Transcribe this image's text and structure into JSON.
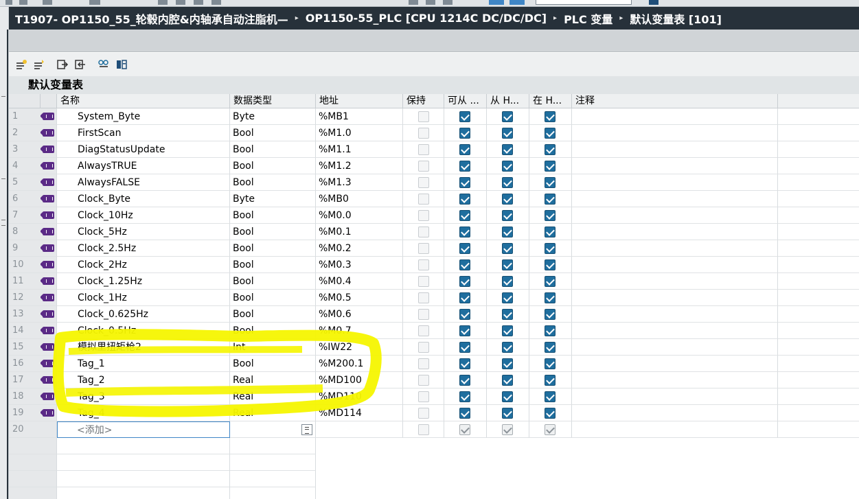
{
  "breadcrumb": [
    "T1907- OP1150_55_轮毂内腔&内轴承自动注脂机—",
    "OP1150-55_PLC [CPU 1214C DC/DC/DC]",
    "PLC 变量",
    "默认变量表 [101]"
  ],
  "breadcrumb_separator": "▸",
  "table_title": "默认变量表",
  "columns": {
    "name": "名称",
    "type": "数据类型",
    "address": "地址",
    "retain": "保持",
    "hmi_accessible": "可从 ...",
    "hmi_visible": "从 H...",
    "hmi_setpoint": "在 H...",
    "comment": "注释"
  },
  "rows": [
    {
      "num": "1",
      "name": "System_Byte",
      "type": "Byte",
      "address": "%MB1",
      "retain": false,
      "hmi1": true,
      "hmi2": true,
      "hmi3": true,
      "highlighted": false
    },
    {
      "num": "2",
      "name": "FirstScan",
      "type": "Bool",
      "address": "%M1.0",
      "retain": false,
      "hmi1": true,
      "hmi2": true,
      "hmi3": true,
      "highlighted": false
    },
    {
      "num": "3",
      "name": "DiagStatusUpdate",
      "type": "Bool",
      "address": "%M1.1",
      "retain": false,
      "hmi1": true,
      "hmi2": true,
      "hmi3": true,
      "highlighted": false
    },
    {
      "num": "4",
      "name": "AlwaysTRUE",
      "type": "Bool",
      "address": "%M1.2",
      "retain": false,
      "hmi1": true,
      "hmi2": true,
      "hmi3": true,
      "highlighted": false
    },
    {
      "num": "5",
      "name": "AlwaysFALSE",
      "type": "Bool",
      "address": "%M1.3",
      "retain": false,
      "hmi1": true,
      "hmi2": true,
      "hmi3": true,
      "highlighted": false
    },
    {
      "num": "6",
      "name": "Clock_Byte",
      "type": "Byte",
      "address": "%MB0",
      "retain": false,
      "hmi1": true,
      "hmi2": true,
      "hmi3": true,
      "highlighted": false
    },
    {
      "num": "7",
      "name": "Clock_10Hz",
      "type": "Bool",
      "address": "%M0.0",
      "retain": false,
      "hmi1": true,
      "hmi2": true,
      "hmi3": true,
      "highlighted": false
    },
    {
      "num": "8",
      "name": "Clock_5Hz",
      "type": "Bool",
      "address": "%M0.1",
      "retain": false,
      "hmi1": true,
      "hmi2": true,
      "hmi3": true,
      "highlighted": false
    },
    {
      "num": "9",
      "name": "Clock_2.5Hz",
      "type": "Bool",
      "address": "%M0.2",
      "retain": false,
      "hmi1": true,
      "hmi2": true,
      "hmi3": true,
      "highlighted": false
    },
    {
      "num": "10",
      "name": "Clock_2Hz",
      "type": "Bool",
      "address": "%M0.3",
      "retain": false,
      "hmi1": true,
      "hmi2": true,
      "hmi3": true,
      "highlighted": false
    },
    {
      "num": "11",
      "name": "Clock_1.25Hz",
      "type": "Bool",
      "address": "%M0.4",
      "retain": false,
      "hmi1": true,
      "hmi2": true,
      "hmi3": true,
      "highlighted": false
    },
    {
      "num": "12",
      "name": "Clock_1Hz",
      "type": "Bool",
      "address": "%M0.5",
      "retain": false,
      "hmi1": true,
      "hmi2": true,
      "hmi3": true,
      "highlighted": false
    },
    {
      "num": "13",
      "name": "Clock_0.625Hz",
      "type": "Bool",
      "address": "%M0.6",
      "retain": false,
      "hmi1": true,
      "hmi2": true,
      "hmi3": true,
      "highlighted": false
    },
    {
      "num": "14",
      "name": "Clock_0.5Hz",
      "type": "Bool",
      "address": "%M0.7",
      "retain": false,
      "hmi1": true,
      "hmi2": true,
      "hmi3": true,
      "highlighted": false
    },
    {
      "num": "15",
      "name": "模拟里扭矩枪2",
      "type": "Int",
      "address": "%IW22",
      "retain": false,
      "hmi1": true,
      "hmi2": true,
      "hmi3": true,
      "highlighted": true
    },
    {
      "num": "16",
      "name": "Tag_1",
      "type": "Bool",
      "address": "%M200.1",
      "retain": false,
      "hmi1": true,
      "hmi2": true,
      "hmi3": true,
      "highlighted": true
    },
    {
      "num": "17",
      "name": "Tag_2",
      "type": "Real",
      "address": "%MD100",
      "retain": false,
      "hmi1": true,
      "hmi2": true,
      "hmi3": true,
      "highlighted": true
    },
    {
      "num": "18",
      "name": "Tag_3",
      "type": "Real",
      "address": "%MD110",
      "retain": false,
      "hmi1": true,
      "hmi2": true,
      "hmi3": true,
      "highlighted": true
    },
    {
      "num": "19",
      "name": "Tag_4",
      "type": "Real",
      "address": "%MD114",
      "retain": false,
      "hmi1": true,
      "hmi2": true,
      "hmi3": true,
      "highlighted": false
    }
  ],
  "add_row": {
    "num": "20",
    "placeholder": "<添加>"
  },
  "highlight_color": "#f5f500",
  "accent_color": "#1f6e9e",
  "title_bar_color": "#27313a",
  "tag_icon_color": "#5a2a86",
  "toolbar_icons": [
    "add-row-icon",
    "insert-row-icon",
    "export-icon",
    "import-icon",
    "monitor-icon",
    "all-values-icon"
  ]
}
